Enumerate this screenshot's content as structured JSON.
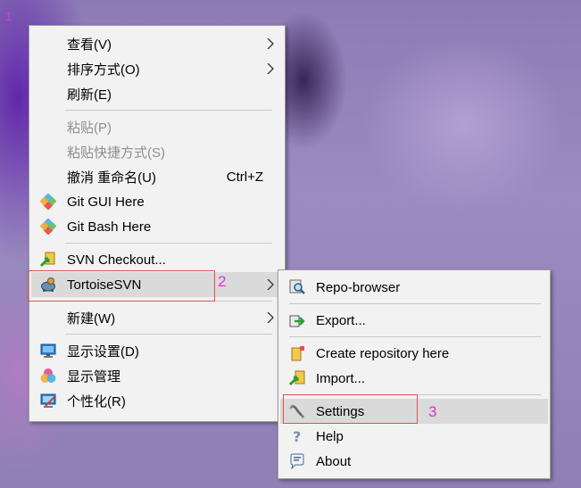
{
  "background": {
    "corner_marker": "1"
  },
  "context_menu": {
    "items": [
      {
        "label": "查看(V)",
        "submenu": true
      },
      {
        "label": "排序方式(O)",
        "submenu": true
      },
      {
        "label": "刷新(E)"
      },
      {
        "label": "粘贴(P)",
        "disabled": true
      },
      {
        "label": "粘贴快捷方式(S)",
        "disabled": true
      },
      {
        "label": "撤消 重命名(U)",
        "shortcut": "Ctrl+Z"
      },
      {
        "label": "Git GUI Here",
        "icon": "git-gui-icon"
      },
      {
        "label": "Git Bash Here",
        "icon": "git-bash-icon"
      },
      {
        "label": "SVN Checkout...",
        "icon": "svn-checkout-icon"
      },
      {
        "label": "TortoiseSVN",
        "icon": "tortoisesvn-icon",
        "submenu": true,
        "highlighted": true
      },
      {
        "label": "新建(W)",
        "submenu": true
      },
      {
        "label": "显示设置(D)",
        "icon": "display-settings-icon"
      },
      {
        "label": "显示管理",
        "icon": "display-management-icon"
      },
      {
        "label": "个性化(R)",
        "icon": "personalize-icon"
      }
    ]
  },
  "svn_submenu": {
    "items": [
      {
        "label": "Repo-browser",
        "icon": "repo-browser-icon"
      },
      {
        "label": "Export...",
        "icon": "export-icon"
      },
      {
        "label": "Create repository here",
        "icon": "create-repository-icon"
      },
      {
        "label": "Import...",
        "icon": "import-icon"
      },
      {
        "label": "Settings",
        "icon": "settings-icon",
        "highlighted": true
      },
      {
        "label": "Help",
        "icon": "help-icon"
      },
      {
        "label": "About",
        "icon": "about-icon"
      }
    ]
  },
  "callouts": {
    "tortoise_number": "2",
    "settings_number": "3"
  },
  "colors": {
    "menu_bg": "#f2f2f2",
    "highlight": "#dadada",
    "callout_border": "#d9534f",
    "callout_number": "#e030e0"
  }
}
